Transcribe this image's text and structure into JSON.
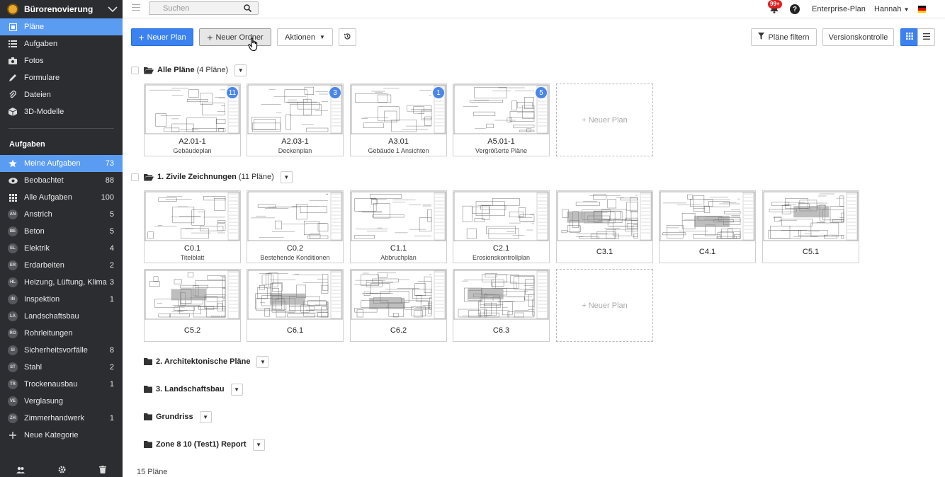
{
  "sidebar": {
    "project": "Bürorenovierung",
    "nav": [
      {
        "label": "Pläne",
        "icon": "plans-icon"
      },
      {
        "label": "Aufgaben",
        "icon": "list-icon"
      },
      {
        "label": "Fotos",
        "icon": "camera-icon"
      },
      {
        "label": "Formulare",
        "icon": "form-icon"
      },
      {
        "label": "Dateien",
        "icon": "paperclip-icon"
      },
      {
        "label": "3D-Modelle",
        "icon": "cube-icon"
      }
    ],
    "tasks_heading": "Aufgaben",
    "tasks": [
      {
        "label": "Meine Aufgaben",
        "count": "73",
        "icon": "star-icon"
      },
      {
        "label": "Beobachtet",
        "count": "88",
        "icon": "eye-icon"
      },
      {
        "label": "Alle Aufgaben",
        "count": "100",
        "icon": "grid-icon"
      }
    ],
    "categories": [
      {
        "abbr": "AN",
        "label": "Anstrich",
        "count": "5"
      },
      {
        "abbr": "BE",
        "label": "Beton",
        "count": "5"
      },
      {
        "abbr": "EL",
        "label": "Elektrik",
        "count": "4"
      },
      {
        "abbr": "ER",
        "label": "Erdarbeiten",
        "count": "2"
      },
      {
        "abbr": "HL",
        "label": "Heizung, Lüftung, Klima",
        "count": "3"
      },
      {
        "abbr": "IN",
        "label": "Inspektion",
        "count": "1"
      },
      {
        "abbr": "LA",
        "label": "Landschaftsbau",
        "count": ""
      },
      {
        "abbr": "RO",
        "label": "Rohrleitungen",
        "count": ""
      },
      {
        "abbr": "SI",
        "label": "Sicherheitsvorfälle",
        "count": "8"
      },
      {
        "abbr": "ST",
        "label": "Stahl",
        "count": "2"
      },
      {
        "abbr": "TR",
        "label": "Trockenausbau",
        "count": "1"
      },
      {
        "abbr": "VE",
        "label": "Verglasung",
        "count": ""
      },
      {
        "abbr": "ZH",
        "label": "Zimmerhandwerk",
        "count": "1"
      }
    ],
    "new_category": "Neue Kategorie"
  },
  "topbar": {
    "search_placeholder": "Suchen",
    "notifications": "99+",
    "plan": "Enterprise-Plan",
    "user": "Hannah"
  },
  "toolbar": {
    "new_plan": "Neuer Plan",
    "new_folder": "Neuer Ordner",
    "actions": "Aktionen",
    "filter": "Pläne filtern",
    "versions": "Versionskontrolle"
  },
  "folders": {
    "all": {
      "title": "Alle Pläne",
      "count": "(4 Pläne)"
    },
    "civil": {
      "title": "1. Zivile Zeichnungen",
      "count": "(11 Pläne)"
    },
    "arch": {
      "title": "2. Architektonische Pläne"
    },
    "land": {
      "title": "3. Landschaftsbau"
    },
    "ground": {
      "title": "Grundriss"
    },
    "zone": {
      "title": "Zone 8 10 (Test1) Report"
    }
  },
  "all_plans": [
    {
      "code": "A2.01-1",
      "name": "Gebäudeplan",
      "badge": "11"
    },
    {
      "code": "A2.03-1",
      "name": "Deckenplan",
      "badge": "3"
    },
    {
      "code": "A3.01",
      "name": "Gebäude 1 Ansichten",
      "badge": "1"
    },
    {
      "code": "A5.01-1",
      "name": "Vergrößerte Pläne",
      "badge": "5"
    }
  ],
  "civil_plans": [
    {
      "code": "C0.1",
      "name": "Titelblatt"
    },
    {
      "code": "C0.2",
      "name": "Bestehende Konditionen"
    },
    {
      "code": "C1.1",
      "name": "Abbruchplan"
    },
    {
      "code": "C2.1",
      "name": "Erosionskontrollplan"
    },
    {
      "code": "C3.1",
      "name": ""
    },
    {
      "code": "C4.1",
      "name": ""
    },
    {
      "code": "C5.1",
      "name": ""
    },
    {
      "code": "C5.2",
      "name": ""
    },
    {
      "code": "C6.1",
      "name": ""
    },
    {
      "code": "C6.2",
      "name": ""
    },
    {
      "code": "C6.3",
      "name": ""
    }
  ],
  "new_plan_card": "+ Neuer Plan",
  "footer": "15 Pläne",
  "colors": {
    "sidebar": "#2b2d31",
    "accent": "#5b9cf3",
    "primary_button": "#3b82f0",
    "badge": "#4a86e8",
    "notification": "#e02020"
  }
}
